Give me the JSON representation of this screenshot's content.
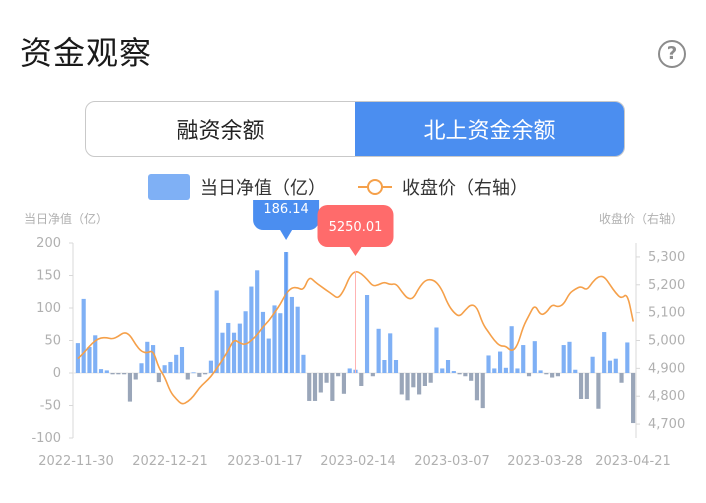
{
  "header": {
    "title": "资金观察",
    "help_icon": "?"
  },
  "tabs": [
    {
      "label": "融资余额",
      "active": false
    },
    {
      "label": "北上资金余额",
      "active": true
    }
  ],
  "legend": {
    "bar_label": "当日净值（亿）",
    "line_label": "收盘价（右轴）"
  },
  "colors": {
    "accent": "#4b8ef0",
    "bar_positive": "#7fb0f5",
    "bar_negative": "#9aa6b9",
    "line": "#f5a04a",
    "tooltip_line": "#ff6b6b"
  },
  "chart_data": {
    "type": "bar",
    "title": "",
    "ylabel_left": "当日净值（亿）",
    "ylabel_right": "收盘价（右轴）",
    "ylim_left": [
      -100,
      200
    ],
    "ylim_right": [
      4650,
      5350
    ],
    "yticks_left": [
      "200",
      "150",
      "100",
      "50",
      "0",
      "-50",
      "-100"
    ],
    "yticks_right": [
      "5,300",
      "5,200",
      "5,100",
      "5,000",
      "4,900",
      "4,800",
      "4,700"
    ],
    "xticks": [
      "2022-11-30",
      "2022-12-21",
      "2023-01-17",
      "2023-02-14",
      "2023-03-07",
      "2023-03-28",
      "2023-04-21"
    ],
    "series": [
      {
        "name": "当日净值（亿）",
        "type": "bar",
        "values": [
          46,
          114,
          40,
          58,
          6,
          4,
          -2,
          -2,
          -2,
          -44,
          -10,
          15,
          48,
          43,
          -14,
          12,
          17,
          28,
          40,
          -10,
          1,
          -6,
          -2,
          19,
          127,
          62,
          77,
          62,
          76,
          95,
          133,
          158,
          94,
          53,
          104,
          92,
          186.14,
          117,
          102,
          28,
          -43,
          -43,
          -30,
          -15,
          -43,
          -5,
          -32,
          7,
          5,
          -20,
          120,
          -5,
          68,
          20,
          61,
          20,
          -33,
          -42,
          -22,
          -33,
          -20,
          -15,
          70,
          7,
          20,
          3,
          -2,
          -5,
          -12,
          -42,
          -54,
          27,
          7,
          33,
          8,
          72,
          7,
          43,
          -5,
          49,
          4,
          -2,
          -7,
          -5,
          43,
          48,
          5,
          -40,
          -40,
          25,
          -55,
          63,
          19,
          22,
          -15,
          47,
          -77
        ]
      },
      {
        "name": "收盘价（右轴）",
        "type": "line",
        "values": [
          4935,
          4955,
          4980,
          5000,
          5010,
          5010,
          5005,
          5015,
          5030,
          5020,
          4985,
          4960,
          4955,
          4965,
          4900,
          4870,
          4815,
          4790,
          4770,
          4780,
          4800,
          4830,
          4850,
          4870,
          4900,
          4930,
          4965,
          5005,
          4990,
          4985,
          5000,
          5020,
          5050,
          5070,
          5100,
          5130,
          5170,
          5190,
          5190,
          5180,
          5230,
          5210,
          5195,
          5180,
          5165,
          5150,
          5180,
          5230,
          5250.01,
          5240,
          5220,
          5195,
          5200,
          5210,
          5200,
          5205,
          5175,
          5150,
          5150,
          5190,
          5215,
          5220,
          5210,
          5180,
          5130,
          5100,
          5085,
          5110,
          5130,
          5120,
          5060,
          5030,
          5000,
          4980,
          4980,
          4960,
          4980,
          5050,
          5090,
          5130,
          5090,
          5100,
          5130,
          5120,
          5130,
          5170,
          5185,
          5195,
          5180,
          5210,
          5230,
          5230,
          5200,
          5170,
          5150,
          5170,
          5070
        ]
      }
    ],
    "highlight_points": [
      {
        "label": "186.14",
        "series": "当日净值（亿）",
        "index": 36
      },
      {
        "label": "5250.01",
        "series": "收盘价（右轴）",
        "index": 48
      }
    ]
  }
}
